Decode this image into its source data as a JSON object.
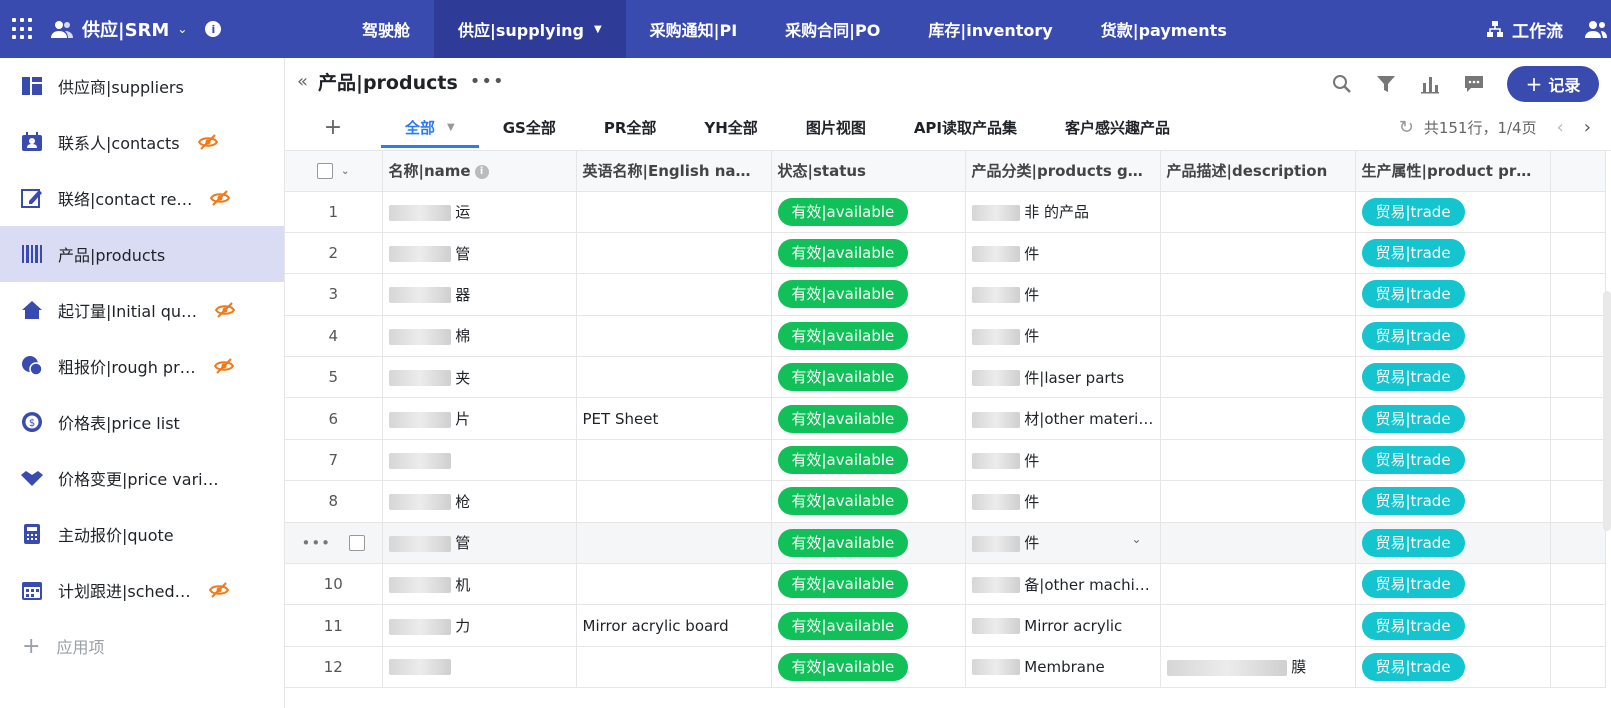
{
  "topbar": {
    "brand": "供应|SRM",
    "nav": [
      {
        "label": "驾驶舱"
      },
      {
        "label": "供应|supplying",
        "active": true,
        "dropdown": true
      },
      {
        "label": "采购通知|PI"
      },
      {
        "label": "采购合同|PO"
      },
      {
        "label": "库存|inventory"
      },
      {
        "label": "货款|payments"
      }
    ],
    "workflow": "工作流"
  },
  "sidebar": {
    "items": [
      {
        "label": "供应商|suppliers",
        "icon": "dashboard-icon",
        "hidden": false
      },
      {
        "label": "联系人|contacts",
        "icon": "contact-card-icon",
        "hidden": true
      },
      {
        "label": "联络|contact re…",
        "icon": "edit-note-icon",
        "hidden": true
      },
      {
        "label": "产品|products",
        "icon": "barcode-icon",
        "hidden": false,
        "active": true
      },
      {
        "label": "起订量|Initial qu…",
        "icon": "home-icon",
        "hidden": true
      },
      {
        "label": "粗报价|rough pr…",
        "icon": "chat-bubbles-icon",
        "hidden": true
      },
      {
        "label": "价格表|price list",
        "icon": "dollar-coin-icon",
        "hidden": false
      },
      {
        "label": "价格变更|price vari…",
        "icon": "handshake-icon",
        "hidden": false
      },
      {
        "label": "主动报价|quote",
        "icon": "calculator-icon",
        "hidden": false
      },
      {
        "label": "计划跟进|sched…",
        "icon": "calendar-icon",
        "hidden": true
      }
    ],
    "add_label": "应用项"
  },
  "main": {
    "title": "产品|products",
    "add_record": "记录",
    "tabs": [
      {
        "label": "全部",
        "active": true
      },
      {
        "label": "GS全部"
      },
      {
        "label": "PR全部"
      },
      {
        "label": "YH全部"
      },
      {
        "label": "图片视图"
      },
      {
        "label": "API读取产品集"
      },
      {
        "label": "客户感兴趣产品"
      }
    ],
    "pager": "共151行，1/4页"
  },
  "table": {
    "columns": [
      "名称|name",
      "英语名称|English na…",
      "状态|status",
      "产品分类|products g…",
      "产品描述|description",
      "生产属性|product pr…"
    ],
    "rows": [
      {
        "num": "1",
        "name": "运",
        "en": "",
        "status": "有效|available",
        "cat": "非 的产品",
        "desc": "",
        "prop": "贸易|trade"
      },
      {
        "num": "2",
        "name": "管",
        "en": "",
        "status": "有效|available",
        "cat": "件",
        "desc": "",
        "prop": "贸易|trade"
      },
      {
        "num": "3",
        "name": "器",
        "en": "",
        "status": "有效|available",
        "cat": "件",
        "desc": "",
        "prop": "贸易|trade"
      },
      {
        "num": "4",
        "name": "棉",
        "en": "",
        "status": "有效|available",
        "cat": "件",
        "desc": "",
        "prop": "贸易|trade"
      },
      {
        "num": "5",
        "name": "夹",
        "en": "",
        "status": "有效|available",
        "cat": "件|laser parts",
        "desc": "",
        "prop": "贸易|trade"
      },
      {
        "num": "6",
        "name": "片",
        "en": "PET Sheet",
        "status": "有效|available",
        "cat": "材|other materials",
        "desc": "",
        "prop": "贸易|trade"
      },
      {
        "num": "7",
        "name": "",
        "en": "",
        "status": "有效|available",
        "cat": "件",
        "desc": "",
        "prop": "贸易|trade"
      },
      {
        "num": "8",
        "name": "枪",
        "en": "",
        "status": "有效|available",
        "cat": "件",
        "desc": "",
        "prop": "贸易|trade"
      },
      {
        "num": "",
        "name": "管",
        "en": "",
        "status": "有效|available",
        "cat": "件",
        "desc": "",
        "prop": "贸易|trade",
        "hover": true
      },
      {
        "num": "10",
        "name": "机",
        "en": "",
        "status": "有效|available",
        "cat": "备|other machines",
        "desc": "",
        "prop": "贸易|trade"
      },
      {
        "num": "11",
        "name": "力",
        "en": "Mirror acrylic board",
        "status": "有效|available",
        "cat": "Mirror acrylic",
        "desc": "",
        "prop": "贸易|trade"
      },
      {
        "num": "12",
        "name": "",
        "en": "",
        "status": "有效|available",
        "cat": "Membrane",
        "desc": "膜",
        "prop": "贸易|trade"
      }
    ]
  },
  "colors": {
    "topbar": "#3a4bb0",
    "active_tab": "#2d7cf0",
    "status_green": "#11c058",
    "trade_teal": "#14c4cf",
    "eye_orange": "#f07a1a"
  }
}
